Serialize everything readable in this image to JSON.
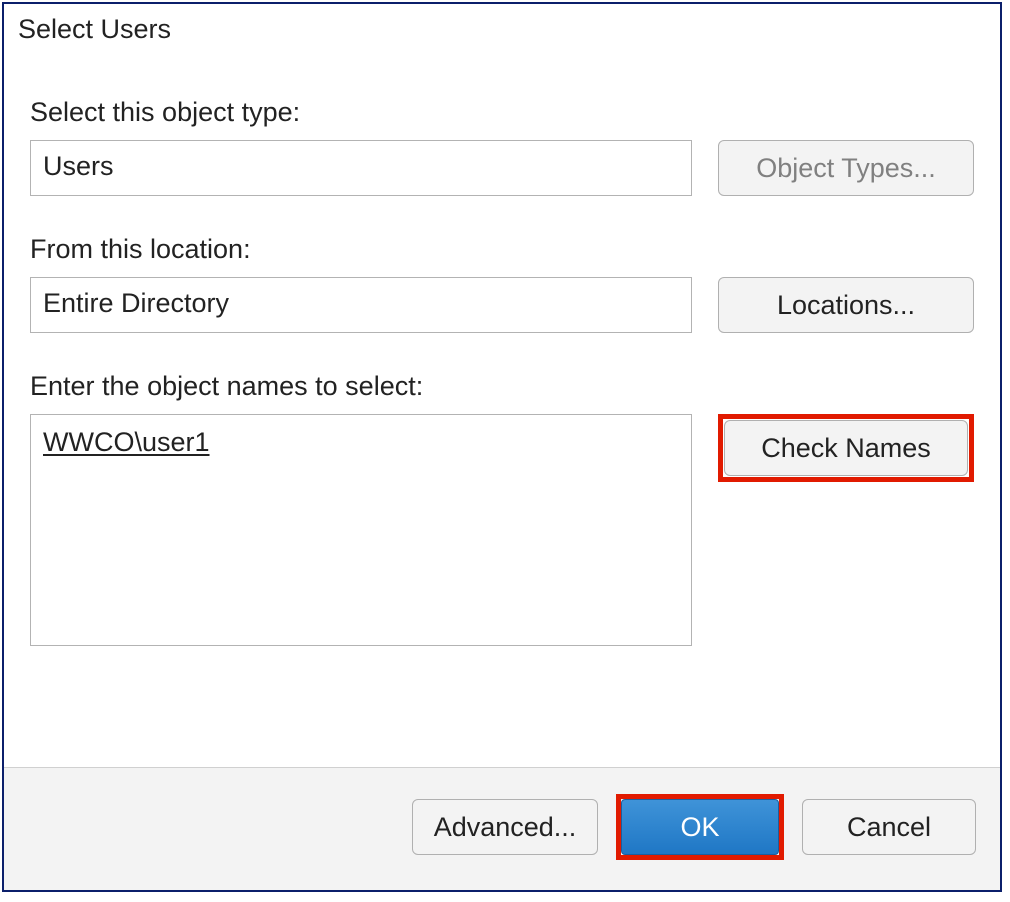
{
  "title": "Select Users",
  "section1": {
    "label": "Select this object type:",
    "value": "Users",
    "button": "Object Types..."
  },
  "section2": {
    "label": "From this location:",
    "value": "Entire Directory",
    "button": "Locations..."
  },
  "section3": {
    "label": "Enter the object names to select:",
    "value": "WWCO\\user1",
    "button": "Check Names"
  },
  "footer": {
    "advanced": "Advanced...",
    "ok": "OK",
    "cancel": "Cancel"
  }
}
